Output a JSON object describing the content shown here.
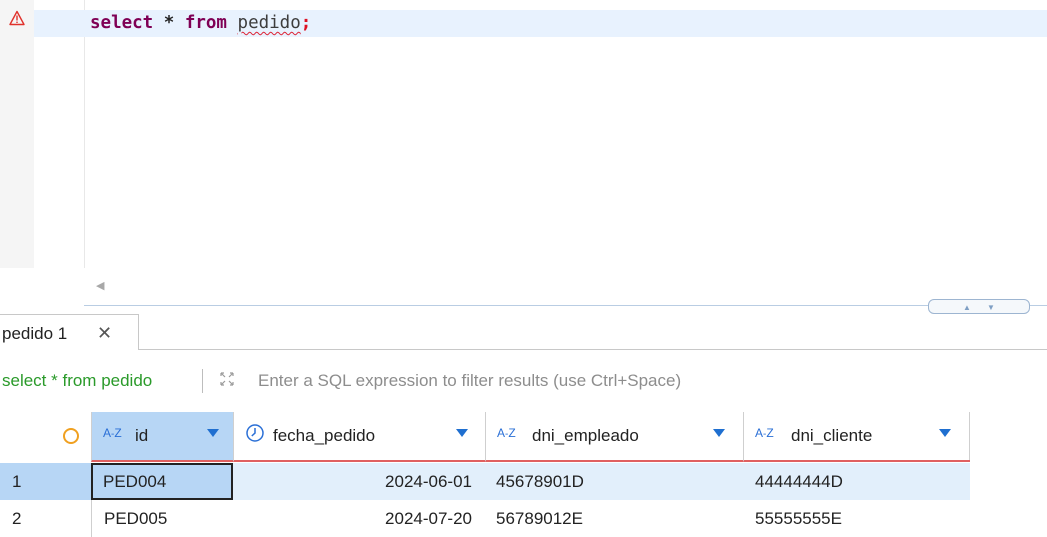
{
  "editor": {
    "warning_icon": "warning-triangle-icon",
    "sql": {
      "select_kw": "select",
      "star": " * ",
      "from_kw": "from",
      "table": "pedido",
      "semicolon": ";"
    },
    "scroll_left_icon": "scroll-left-arrow-icon"
  },
  "results_tab": {
    "label": "pedido 1",
    "close_glyph": "✕"
  },
  "filter": {
    "query": "select * from pedido",
    "placeholder": "Enter a SQL expression to filter results (use Ctrl+Space)",
    "expand_icon": "expand-arrows-icon"
  },
  "grid": {
    "columns": [
      {
        "name": "id",
        "type_icon": "A-Z",
        "kind": "text"
      },
      {
        "name": "fecha_pedido",
        "type_icon": "clock",
        "kind": "date"
      },
      {
        "name": "dni_empleado",
        "type_icon": "A-Z",
        "kind": "text"
      },
      {
        "name": "dni_cliente",
        "type_icon": "A-Z",
        "kind": "text"
      }
    ],
    "rows": [
      {
        "num": "1",
        "id": "PED004",
        "fecha_pedido": "2024-06-01",
        "dni_empleado": "45678901D",
        "dni_cliente": "44444444D"
      },
      {
        "num": "2",
        "id": "PED005",
        "fecha_pedido": "2024-07-20",
        "dni_empleado": "56789012E",
        "dni_cliente": "55555555E"
      }
    ]
  },
  "colors": {
    "keyword": "#7f0055",
    "filter_query": "#2a9a2a",
    "selection": "#b7d6f5",
    "header_underline": "#e06060"
  }
}
